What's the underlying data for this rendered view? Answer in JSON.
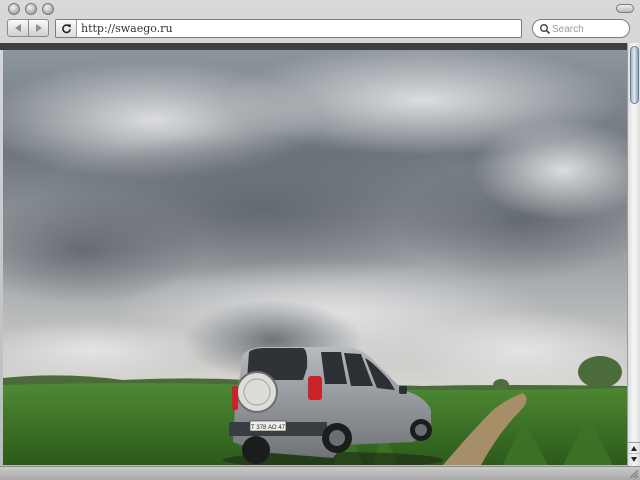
{
  "browser": {
    "url": "http://swaego.ru",
    "search_placeholder": "Search",
    "nav": {
      "back_icon": "back-arrow-icon",
      "forward_icon": "forward-arrow-icon",
      "reload_icon": "reload-icon"
    }
  },
  "page": {
    "content_image": "sky-clouds-suv-on-field-photo",
    "license_plate": "Т 378 АО 47"
  },
  "colors": {
    "sky": "#b9bec3",
    "grass": "#3f7a2a",
    "suv_body": "#9a9ea3"
  }
}
